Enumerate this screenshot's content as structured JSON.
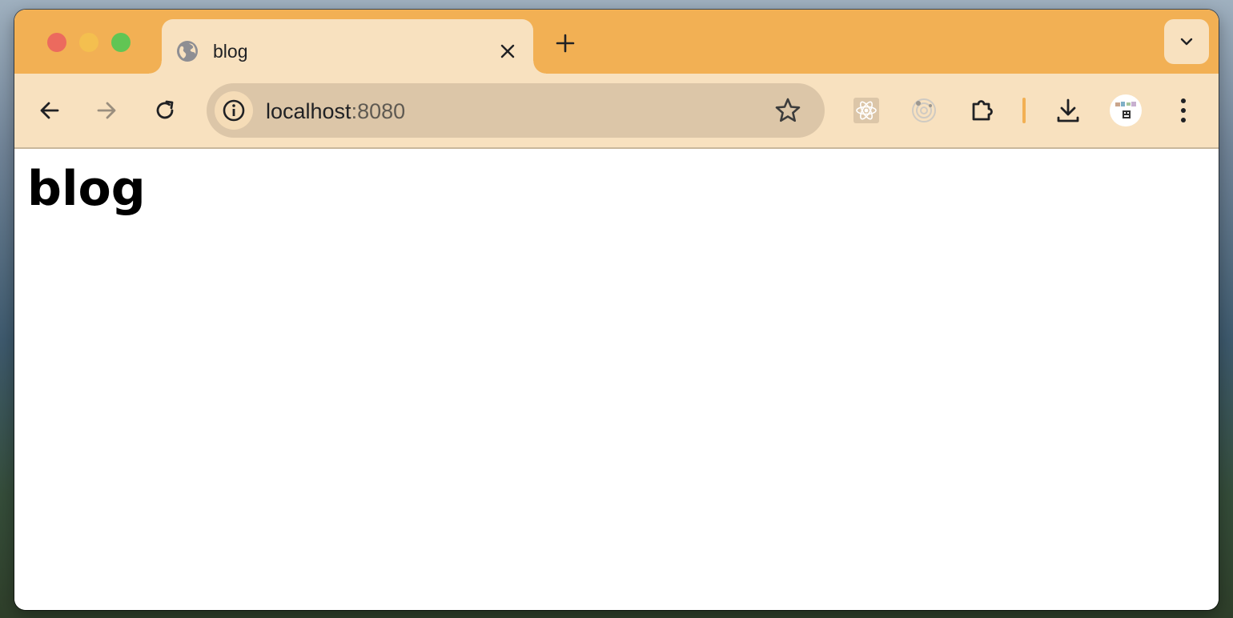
{
  "tab": {
    "title": "blog",
    "favicon": "globe-icon"
  },
  "toolbar": {
    "url_host": "localhost",
    "url_port": ":8080",
    "extensions": [
      "react-devtools-icon",
      "radar-extension-icon",
      "puzzle-piece-icon"
    ],
    "accent_color": "#f2b054",
    "toolbar_color": "#f8e1bf"
  },
  "page": {
    "heading": "blog"
  }
}
